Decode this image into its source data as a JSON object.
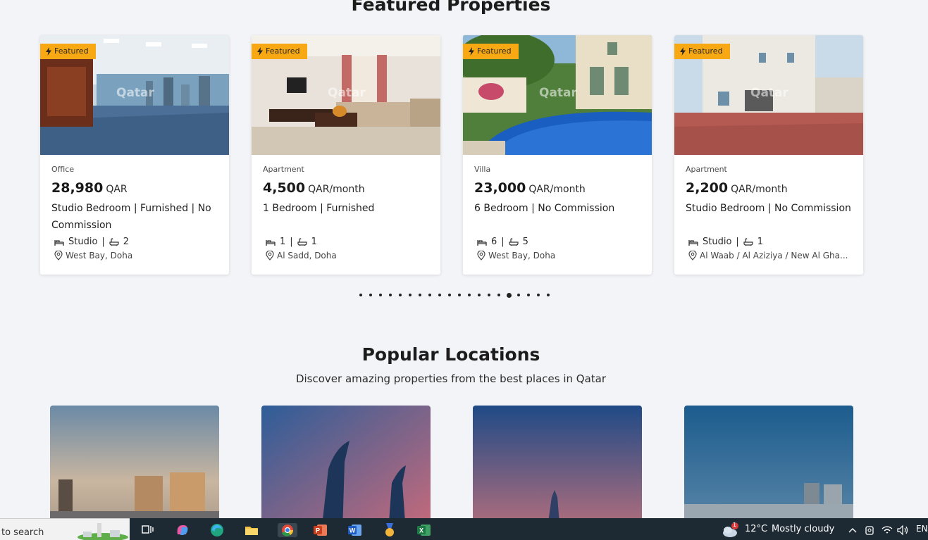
{
  "featured": {
    "title": "Featured Properties",
    "badge_label": "Featured",
    "watermark": "Qatar",
    "cards": [
      {
        "type": "Office",
        "price": "28,980",
        "unit": "QAR",
        "title": "Studio Bedroom | Furnished | No Commission",
        "beds": "Studio",
        "sep1": "|",
        "baths": "2",
        "sep2": "",
        "location": "West Bay, Doha"
      },
      {
        "type": "Apartment",
        "price": "4,500",
        "unit": "QAR/month",
        "title": "1 Bedroom | Furnished",
        "beds": "1",
        "sep1": "|",
        "baths": "1",
        "sep2": "",
        "location": "Al Sadd, Doha"
      },
      {
        "type": "Villa",
        "price": "23,000",
        "unit": "QAR/month",
        "title": "6 Bedroom | No Commission",
        "beds": "6",
        "sep1": "|",
        "baths": "5",
        "sep2": "",
        "location": "West Bay, Doha"
      },
      {
        "type": "Apartment",
        "price": "2,200",
        "unit": "QAR/month",
        "title": "Studio Bedroom | No Commission",
        "beds": "Studio",
        "sep1": "|",
        "baths": "1",
        "sep2": "",
        "location": "Al Waab / Al Aziziya / New Al Gha..."
      }
    ],
    "carousel": {
      "total_dots": 20,
      "active_index": 15
    }
  },
  "popular": {
    "title": "Popular Locations",
    "subtitle": "Discover amazing properties from the best places in Qatar"
  },
  "taskbar": {
    "search_text": "to search",
    "weather_temp": "12°C",
    "weather_desc": "Mostly cloudy",
    "weather_badge": "1",
    "language": "EN"
  },
  "colors": {
    "badge": "#f8a812",
    "page_bg": "#f3f4f7",
    "taskbar": "#1e2a33"
  }
}
